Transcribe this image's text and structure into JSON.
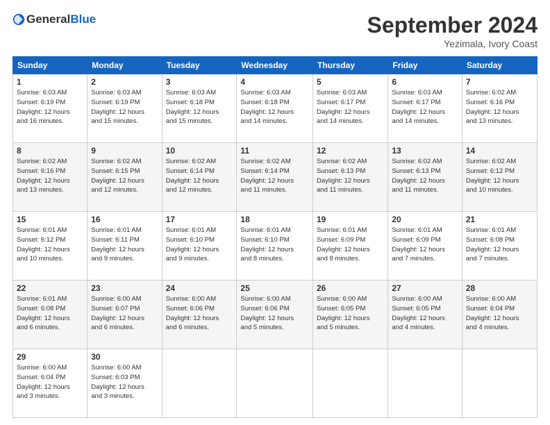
{
  "header": {
    "logo_general": "General",
    "logo_blue": "Blue",
    "month": "September 2024",
    "location": "Yezimala, Ivory Coast"
  },
  "days_of_week": [
    "Sunday",
    "Monday",
    "Tuesday",
    "Wednesday",
    "Thursday",
    "Friday",
    "Saturday"
  ],
  "weeks": [
    [
      {
        "day": "1",
        "sunrise": "6:03 AM",
        "sunset": "6:19 PM",
        "daylight": "12 hours and 16 minutes."
      },
      {
        "day": "2",
        "sunrise": "6:03 AM",
        "sunset": "6:19 PM",
        "daylight": "12 hours and 15 minutes."
      },
      {
        "day": "3",
        "sunrise": "6:03 AM",
        "sunset": "6:18 PM",
        "daylight": "12 hours and 15 minutes."
      },
      {
        "day": "4",
        "sunrise": "6:03 AM",
        "sunset": "6:18 PM",
        "daylight": "12 hours and 14 minutes."
      },
      {
        "day": "5",
        "sunrise": "6:03 AM",
        "sunset": "6:17 PM",
        "daylight": "12 hours and 14 minutes."
      },
      {
        "day": "6",
        "sunrise": "6:03 AM",
        "sunset": "6:17 PM",
        "daylight": "12 hours and 14 minutes."
      },
      {
        "day": "7",
        "sunrise": "6:02 AM",
        "sunset": "6:16 PM",
        "daylight": "12 hours and 13 minutes."
      }
    ],
    [
      {
        "day": "8",
        "sunrise": "6:02 AM",
        "sunset": "6:16 PM",
        "daylight": "12 hours and 13 minutes."
      },
      {
        "day": "9",
        "sunrise": "6:02 AM",
        "sunset": "6:15 PM",
        "daylight": "12 hours and 12 minutes."
      },
      {
        "day": "10",
        "sunrise": "6:02 AM",
        "sunset": "6:14 PM",
        "daylight": "12 hours and 12 minutes."
      },
      {
        "day": "11",
        "sunrise": "6:02 AM",
        "sunset": "6:14 PM",
        "daylight": "12 hours and 11 minutes."
      },
      {
        "day": "12",
        "sunrise": "6:02 AM",
        "sunset": "6:13 PM",
        "daylight": "12 hours and 11 minutes."
      },
      {
        "day": "13",
        "sunrise": "6:02 AM",
        "sunset": "6:13 PM",
        "daylight": "12 hours and 11 minutes."
      },
      {
        "day": "14",
        "sunrise": "6:02 AM",
        "sunset": "6:12 PM",
        "daylight": "12 hours and 10 minutes."
      }
    ],
    [
      {
        "day": "15",
        "sunrise": "6:01 AM",
        "sunset": "6:12 PM",
        "daylight": "12 hours and 10 minutes."
      },
      {
        "day": "16",
        "sunrise": "6:01 AM",
        "sunset": "6:11 PM",
        "daylight": "12 hours and 9 minutes."
      },
      {
        "day": "17",
        "sunrise": "6:01 AM",
        "sunset": "6:10 PM",
        "daylight": "12 hours and 9 minutes."
      },
      {
        "day": "18",
        "sunrise": "6:01 AM",
        "sunset": "6:10 PM",
        "daylight": "12 hours and 8 minutes."
      },
      {
        "day": "19",
        "sunrise": "6:01 AM",
        "sunset": "6:09 PM",
        "daylight": "12 hours and 8 minutes."
      },
      {
        "day": "20",
        "sunrise": "6:01 AM",
        "sunset": "6:09 PM",
        "daylight": "12 hours and 7 minutes."
      },
      {
        "day": "21",
        "sunrise": "6:01 AM",
        "sunset": "6:08 PM",
        "daylight": "12 hours and 7 minutes."
      }
    ],
    [
      {
        "day": "22",
        "sunrise": "6:01 AM",
        "sunset": "6:08 PM",
        "daylight": "12 hours and 6 minutes."
      },
      {
        "day": "23",
        "sunrise": "6:00 AM",
        "sunset": "6:07 PM",
        "daylight": "12 hours and 6 minutes."
      },
      {
        "day": "24",
        "sunrise": "6:00 AM",
        "sunset": "6:06 PM",
        "daylight": "12 hours and 6 minutes."
      },
      {
        "day": "25",
        "sunrise": "6:00 AM",
        "sunset": "6:06 PM",
        "daylight": "12 hours and 5 minutes."
      },
      {
        "day": "26",
        "sunrise": "6:00 AM",
        "sunset": "6:05 PM",
        "daylight": "12 hours and 5 minutes."
      },
      {
        "day": "27",
        "sunrise": "6:00 AM",
        "sunset": "6:05 PM",
        "daylight": "12 hours and 4 minutes."
      },
      {
        "day": "28",
        "sunrise": "6:00 AM",
        "sunset": "6:04 PM",
        "daylight": "12 hours and 4 minutes."
      }
    ],
    [
      {
        "day": "29",
        "sunrise": "6:00 AM",
        "sunset": "6:04 PM",
        "daylight": "12 hours and 3 minutes."
      },
      {
        "day": "30",
        "sunrise": "6:00 AM",
        "sunset": "6:03 PM",
        "daylight": "12 hours and 3 minutes."
      },
      null,
      null,
      null,
      null,
      null
    ]
  ],
  "labels": {
    "sunrise": "Sunrise:",
    "sunset": "Sunset:",
    "daylight": "Daylight:"
  }
}
